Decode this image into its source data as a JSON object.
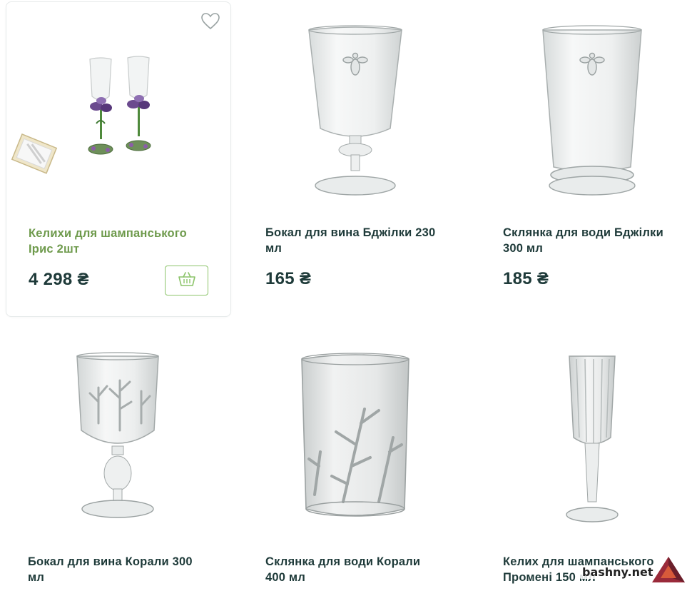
{
  "products": [
    {
      "name": "Келихи для шампанського Ірис 2шт",
      "price": "4 298 ₴",
      "image": "champagne-flutes-iris-set"
    },
    {
      "name": "Бокал для вина Бджілки 230 мл",
      "price": "165 ₴",
      "image": "wine-glass-bee"
    },
    {
      "name": "Склянка для води Бджілки 300 мл",
      "price": "185 ₴",
      "image": "water-tumbler-bee"
    },
    {
      "name": "Бокал для вина Корали 300 мл",
      "price": "",
      "image": "wine-glass-coral"
    },
    {
      "name": "Склянка для води Корали 400 мл",
      "price": "",
      "image": "water-tumbler-coral"
    },
    {
      "name": "Келих для шампанського Промені 150 мл",
      "price": "",
      "image": "champagne-flute-rays"
    }
  ],
  "icons": {
    "wishlist": "heart-outline-icon",
    "cart": "basket-icon"
  },
  "colors": {
    "accent_green": "#8cc46a",
    "title_green": "#6e9a4c",
    "text_dark": "#1e3a39"
  },
  "watermark": {
    "text": "bashny.net"
  }
}
